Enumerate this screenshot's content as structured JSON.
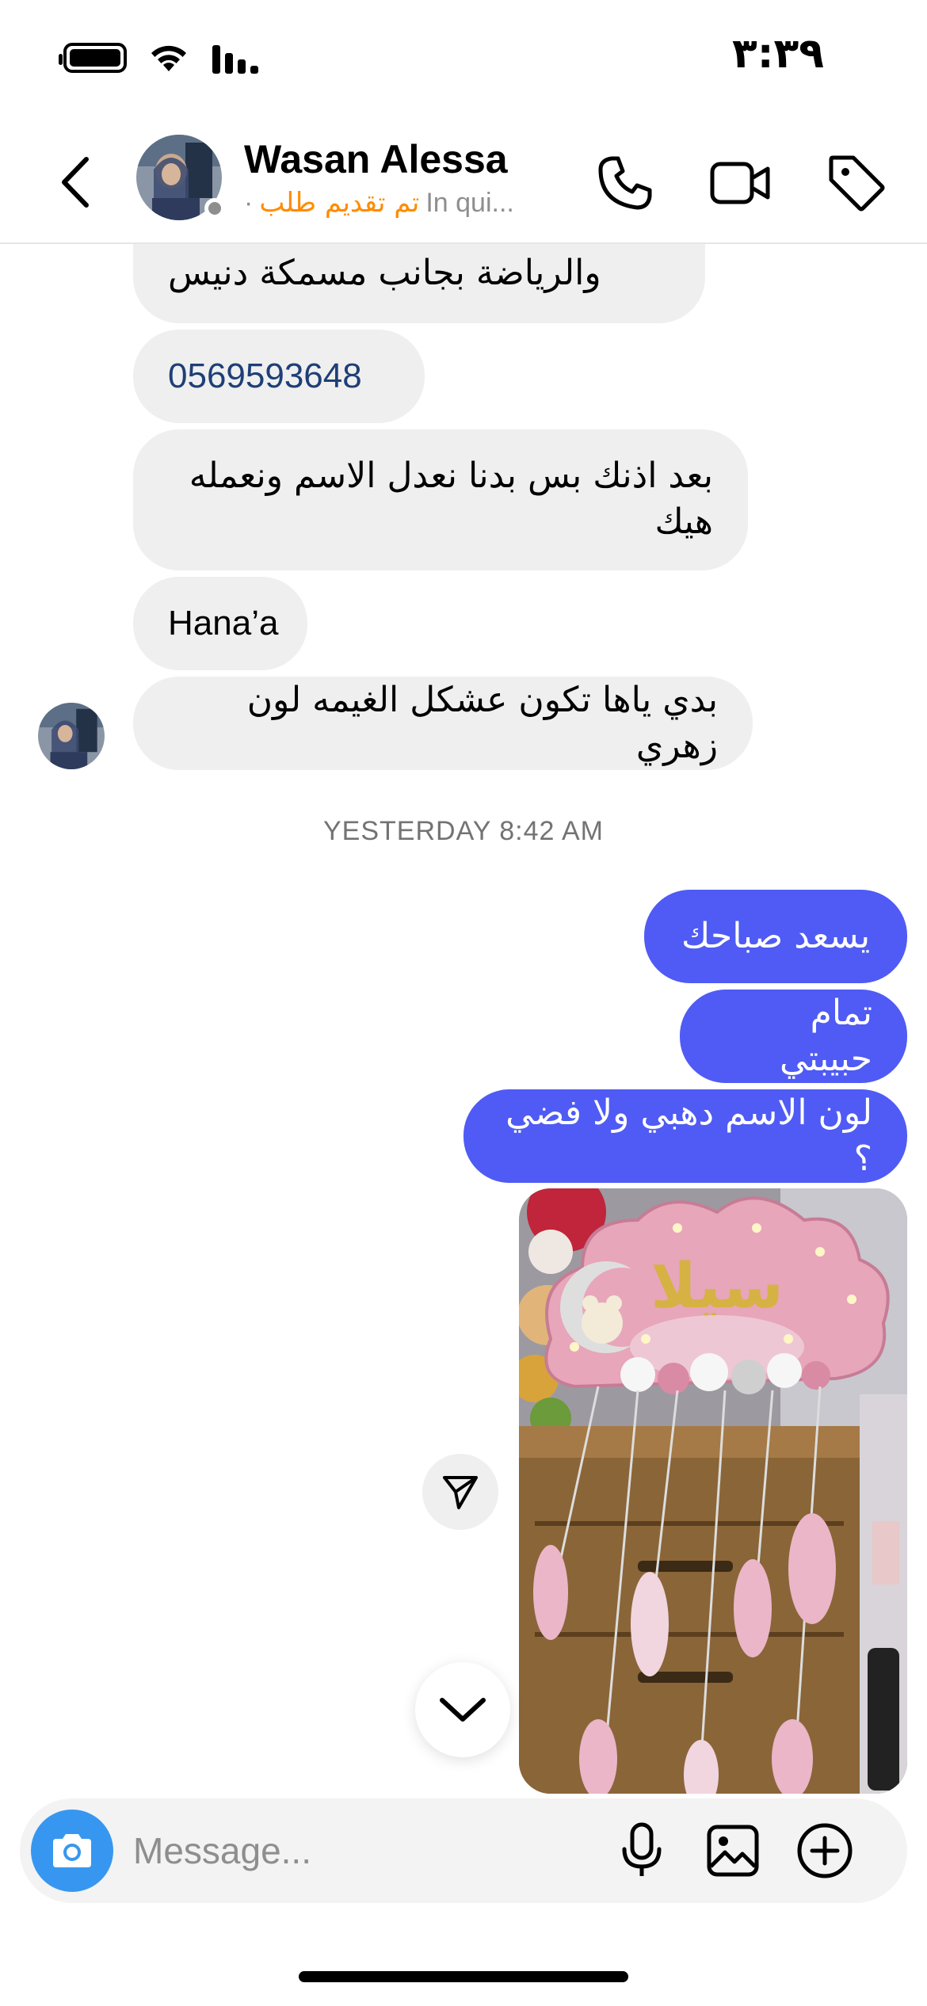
{
  "status_bar": {
    "time": "٣:٣٩"
  },
  "header": {
    "name": "Wasan Alessa",
    "status_label": "تم تقديم طلب",
    "status_sub": "In qui...",
    "dot": "·"
  },
  "messages": {
    "incoming": [
      {
        "text": "والرياضة بجانب مسمكة دنيس"
      },
      {
        "text": "0569593648"
      },
      {
        "text": "بعد اذنك بس بدنا نعدل الاسم ونعمله هيك"
      },
      {
        "text": "Hana’a"
      },
      {
        "text": "بدي ياها تكون عشكل الغيمه لون زهري"
      }
    ],
    "timestamp": "YESTERDAY 8:42 AM",
    "outgoing": [
      {
        "text": "يسعد صباحك"
      },
      {
        "text": "تمام حبيبتي"
      },
      {
        "text": "لون الاسم دهبي ولا فضي ؟"
      }
    ],
    "photo_caption_text": "سيلا"
  },
  "composer": {
    "placeholder": "Message..."
  },
  "icons": {
    "back": "chevron-left-icon",
    "call": "phone-icon",
    "video": "video-camera-icon",
    "tag": "tag-icon",
    "share": "paper-plane-icon",
    "scroll": "chevron-down-icon",
    "camera": "camera-icon",
    "mic": "microphone-icon",
    "gallery": "image-icon",
    "more": "plus-circle-icon"
  },
  "colors": {
    "outgoing_bubble": "#4f5bf4",
    "incoming_bubble": "#efefef",
    "status_accent": "#ff8c00",
    "camera_button": "#3797f0",
    "link_text": "#1e3f77"
  }
}
